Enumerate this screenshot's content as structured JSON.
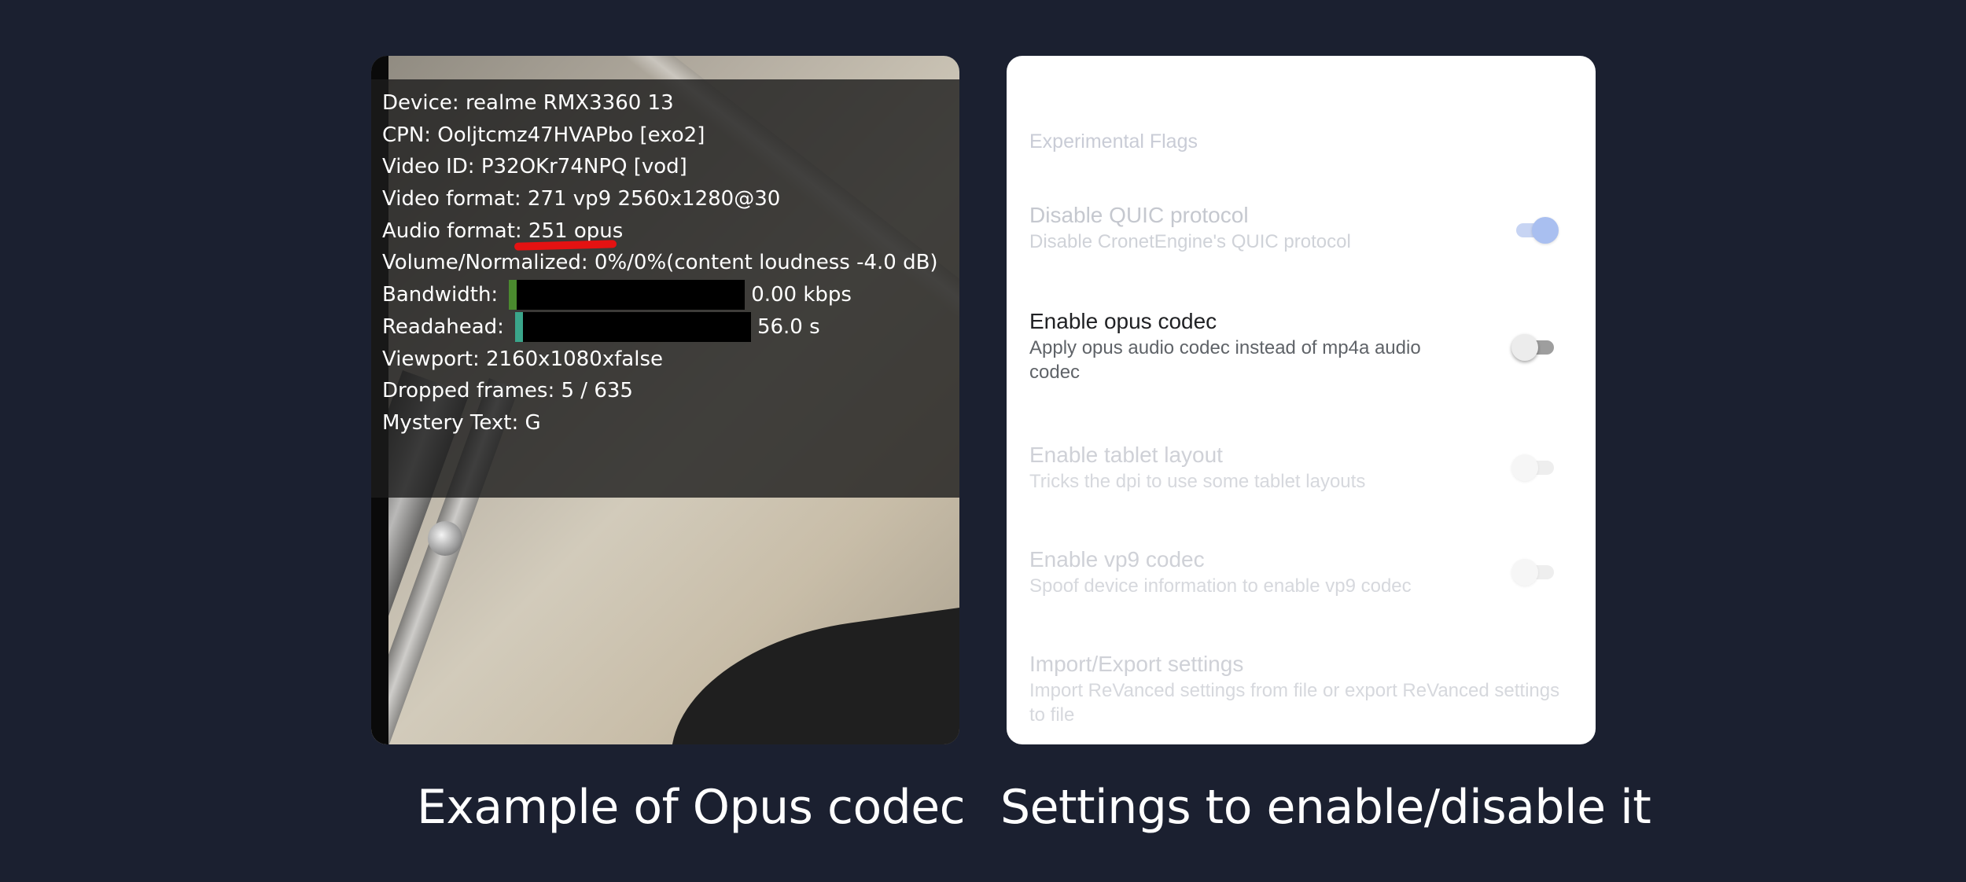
{
  "stats": {
    "device": "Device: realme RMX3360 13",
    "cpn": "CPN: Ooljtcmz47HVAPbo [exo2]",
    "video_id": "Video ID: P32OKr74NPQ [vod]",
    "video_format": "Video format: 271 vp9 2560x1280@30",
    "audio_format": "Audio format: 251 opus",
    "volume": "Volume/Normalized: 0%/0%(content loudness -4.0 dB)",
    "bandwidth_label": "Bandwidth:",
    "bandwidth_value": "0.00 kbps",
    "readahead_label": "Readahead:",
    "readahead_value": "56.0 s",
    "viewport": "Viewport: 2160x1080xfalse",
    "dropped_frames": "Dropped frames: 5 / 635",
    "mystery_text": "Mystery Text: G"
  },
  "settings": {
    "section_header": "Experimental Flags",
    "items": [
      {
        "title": "Disable QUIC protocol",
        "summary": "Disable CronetEngine's QUIC protocol",
        "state": "on",
        "enabled": false
      },
      {
        "title": "Enable opus codec",
        "summary": "Apply opus audio codec instead of mp4a audio codec",
        "state": "off",
        "enabled": true
      },
      {
        "title": "Enable tablet layout",
        "summary": "Tricks the dpi to use some tablet layouts",
        "state": "off",
        "enabled": false
      },
      {
        "title": "Enable vp9 codec",
        "summary": "Spoof device information to enable vp9 codec",
        "state": "off",
        "enabled": false
      },
      {
        "title": "Import/Export settings",
        "summary": "Import ReVanced settings from file or export ReVanced settings to file",
        "enabled": false
      }
    ]
  },
  "captions": {
    "left": "Example of Opus codec",
    "right": "Settings to enable/disable it"
  },
  "colors": {
    "background": "#1b2030",
    "highlight_mark": "#e41212",
    "toggle_on": "#a9bff0"
  }
}
